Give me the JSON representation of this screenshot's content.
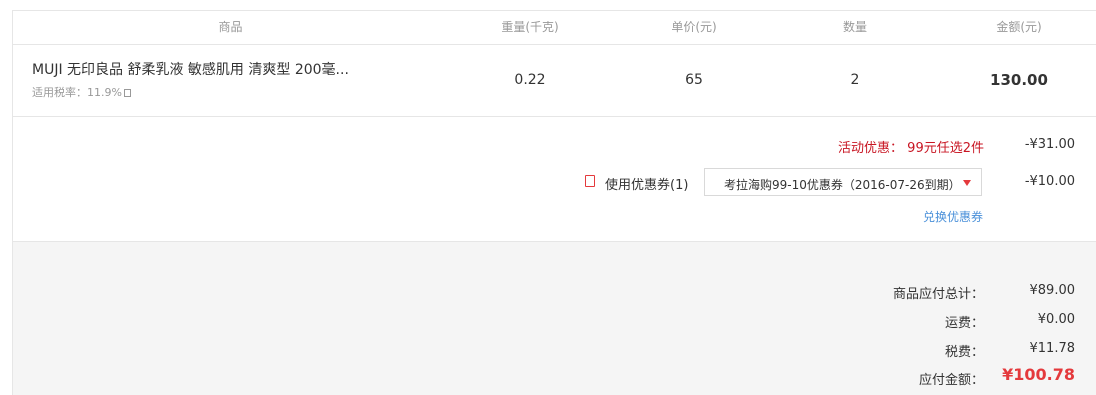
{
  "table": {
    "headers": {
      "product": "商品",
      "weight": "重量(千克)",
      "unit_price": "单价(元)",
      "quantity": "数量",
      "amount": "金额(元)"
    },
    "item": {
      "name": "MUJI 无印良品 舒柔乳液 敏感肌用 清爽型 200毫...",
      "tax_rate": "适用税率：11.9%",
      "weight": "0.22",
      "unit_price": "65",
      "quantity": "2",
      "amount": "130.00"
    }
  },
  "discounts": {
    "promo_label": "活动优惠：",
    "promo_name": "99元任选2件",
    "promo_amount": "-¥31.00",
    "coupon_label": "使用优惠券(1)",
    "coupon_selected": "考拉海购99-10优惠券（2016-07-26到期）",
    "coupon_amount": "-¥10.00",
    "redeem_link": "兑换优惠券"
  },
  "summary": {
    "subtotal_label": "商品应付总计：",
    "subtotal_value": "¥89.00",
    "shipping_label": "运费：",
    "shipping_value": "¥0.00",
    "tax_label": "税费：",
    "tax_value": "¥11.78",
    "total_label": "应付金额：",
    "total_value": "¥100.78"
  },
  "colors": {
    "accent_red": "#e4393c",
    "promo_red": "#c81623",
    "link_blue": "#4a90d9"
  }
}
